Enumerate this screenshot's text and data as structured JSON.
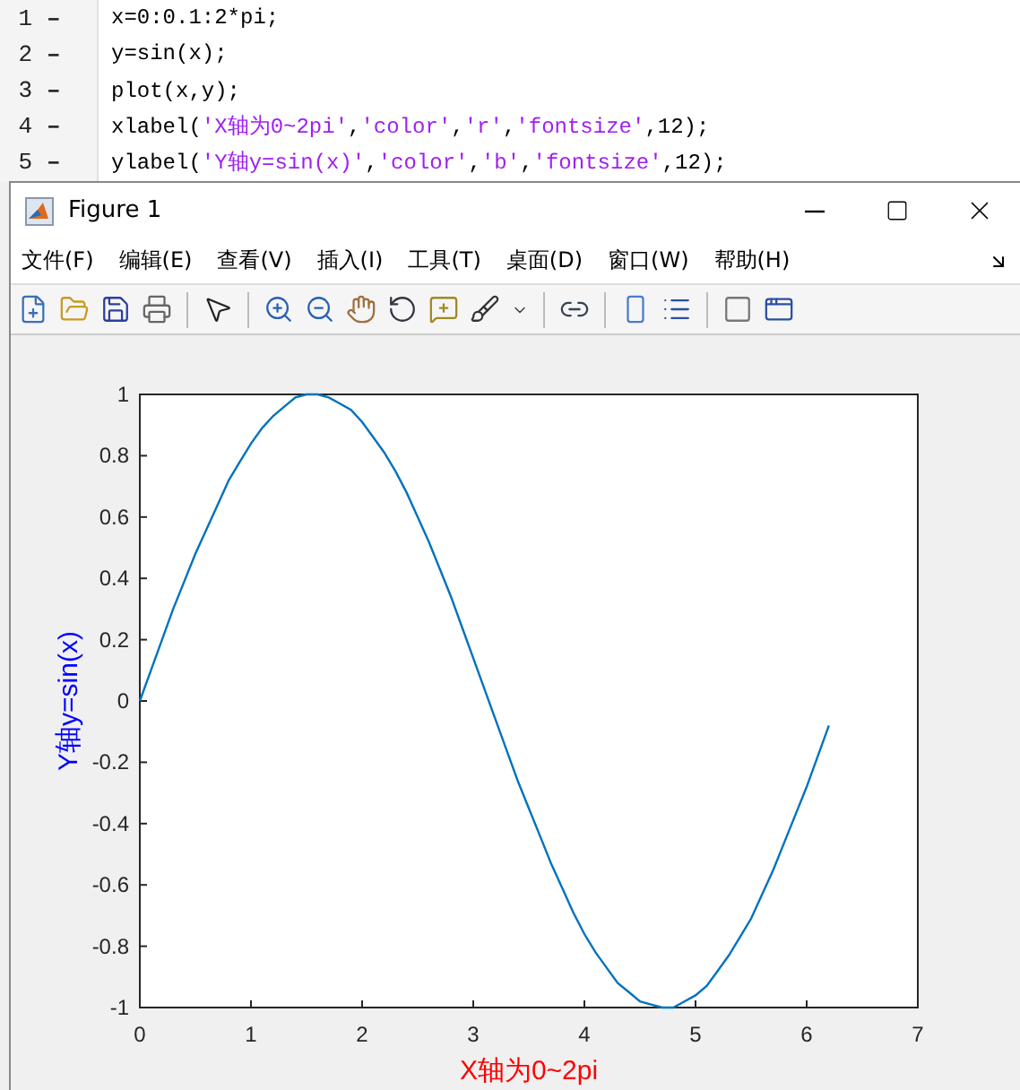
{
  "editor": {
    "lines": [
      {
        "number": "1",
        "marker": "–",
        "segments": [
          {
            "kind": "plain",
            "text": "x=0:0.1:2*pi;"
          }
        ]
      },
      {
        "number": "2",
        "marker": "–",
        "segments": [
          {
            "kind": "plain",
            "text": "y=sin(x);"
          }
        ]
      },
      {
        "number": "3",
        "marker": "–",
        "segments": [
          {
            "kind": "plain",
            "text": "plot(x,y);"
          }
        ]
      },
      {
        "number": "4",
        "marker": "–",
        "segments": [
          {
            "kind": "plain",
            "text": "xlabel("
          },
          {
            "kind": "string",
            "text": "'X轴为0~2pi'"
          },
          {
            "kind": "plain",
            "text": ","
          },
          {
            "kind": "string",
            "text": "'color'"
          },
          {
            "kind": "plain",
            "text": ","
          },
          {
            "kind": "string",
            "text": "'r'"
          },
          {
            "kind": "plain",
            "text": ","
          },
          {
            "kind": "string",
            "text": "'fontsize'"
          },
          {
            "kind": "plain",
            "text": ",12);"
          }
        ]
      },
      {
        "number": "5",
        "marker": "–",
        "segments": [
          {
            "kind": "plain",
            "text": "ylabel("
          },
          {
            "kind": "string",
            "text": "'Y轴y=sin(x)'"
          },
          {
            "kind": "plain",
            "text": ","
          },
          {
            "kind": "string",
            "text": "'color'"
          },
          {
            "kind": "plain",
            "text": ","
          },
          {
            "kind": "string",
            "text": "'b'"
          },
          {
            "kind": "plain",
            "text": ","
          },
          {
            "kind": "string",
            "text": "'fontsize'"
          },
          {
            "kind": "plain",
            "text": ",12);"
          }
        ]
      }
    ]
  },
  "window": {
    "title": "Figure 1"
  },
  "menu": [
    "文件(F)",
    "编辑(E)",
    "查看(V)",
    "插入(I)",
    "工具(T)",
    "桌面(D)",
    "窗口(W)",
    "帮助(H)"
  ],
  "figure": {
    "chart_data": {
      "type": "line",
      "xlabel": "X轴为0~2pi",
      "ylabel": "Y轴y=sin(x)",
      "xlim": [
        0,
        7
      ],
      "ylim": [
        -1,
        1
      ],
      "xticks": [
        0,
        1,
        2,
        3,
        4,
        5,
        6,
        7
      ],
      "yticks": [
        -1,
        -0.8,
        -0.6,
        -0.4,
        -0.2,
        0,
        0.2,
        0.4,
        0.6,
        0.8,
        1
      ],
      "x": [
        0,
        0.1,
        0.2,
        0.3,
        0.4,
        0.5,
        0.6,
        0.7,
        0.8,
        0.9,
        1,
        1.1,
        1.2,
        1.3,
        1.4,
        1.5,
        1.6,
        1.7,
        1.8,
        1.9,
        2,
        2.1,
        2.2,
        2.3,
        2.4,
        2.5,
        2.6,
        2.7,
        2.8,
        2.9,
        3,
        3.1,
        3.2,
        3.3,
        3.4,
        3.5,
        3.6,
        3.7,
        3.8,
        3.9,
        4,
        4.1,
        4.2,
        4.3,
        4.4,
        4.5,
        4.6,
        4.7,
        4.8,
        4.9,
        5,
        5.1,
        5.2,
        5.3,
        5.4,
        5.5,
        5.6,
        5.7,
        5.8,
        5.9,
        6,
        6.1,
        6.2
      ],
      "series": [
        {
          "color": "#0072bd",
          "values": [
            0,
            0.1,
            0.2,
            0.3,
            0.39,
            0.48,
            0.56,
            0.64,
            0.72,
            0.78,
            0.84,
            0.89,
            0.93,
            0.96,
            0.99,
            1,
            1,
            0.99,
            0.97,
            0.95,
            0.91,
            0.86,
            0.81,
            0.75,
            0.68,
            0.6,
            0.52,
            0.43,
            0.34,
            0.24,
            0.14,
            0.04,
            -0.06,
            -0.16,
            -0.26,
            -0.35,
            -0.44,
            -0.53,
            -0.61,
            -0.69,
            -0.76,
            -0.82,
            -0.87,
            -0.92,
            -0.95,
            -0.98,
            -0.99,
            -1,
            -1,
            -0.98,
            -0.96,
            -0.93,
            -0.88,
            -0.83,
            -0.77,
            -0.71,
            -0.63,
            -0.55,
            -0.46,
            -0.37,
            -0.28,
            -0.18,
            -0.08
          ]
        }
      ]
    }
  }
}
